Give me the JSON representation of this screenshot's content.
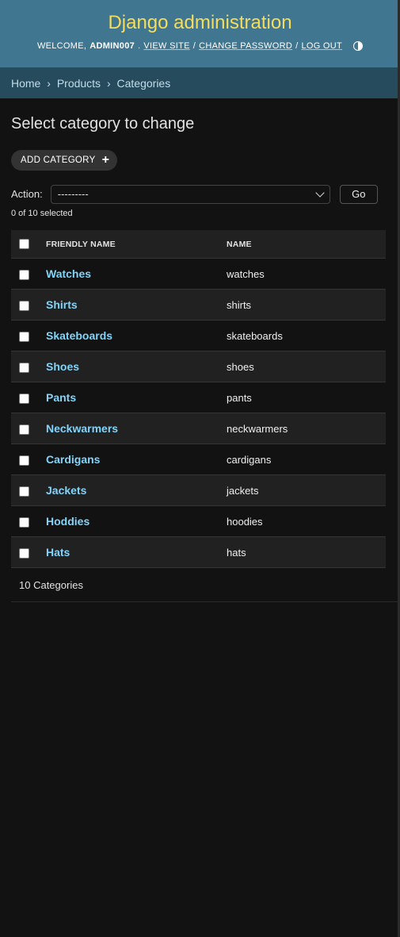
{
  "header": {
    "site_name": "Django administration",
    "welcome": "Welcome,",
    "username": "admin007",
    "view_site": "View site",
    "change_password": "Change password",
    "log_out": "Log out",
    "sep": "/"
  },
  "breadcrumbs": {
    "home": "Home",
    "app": "Products",
    "model": "Categories",
    "sep": "›"
  },
  "page": {
    "title": "Select category to change",
    "add_label": "Add category",
    "add_icon": "+"
  },
  "actions": {
    "label": "Action:",
    "selected_value": "---------",
    "go_label": "Go",
    "counter": "0 of 10 selected"
  },
  "table": {
    "columns": [
      "Friendly name",
      "Name"
    ],
    "rows": [
      {
        "friendly_name": "Watches",
        "name": "watches"
      },
      {
        "friendly_name": "Shirts",
        "name": "shirts"
      },
      {
        "friendly_name": "Skateboards",
        "name": "skateboards"
      },
      {
        "friendly_name": "Shoes",
        "name": "shoes"
      },
      {
        "friendly_name": "Pants",
        "name": "pants"
      },
      {
        "friendly_name": "Neckwarmers",
        "name": "neckwarmers"
      },
      {
        "friendly_name": "Cardigans",
        "name": "cardigans"
      },
      {
        "friendly_name": "Jackets",
        "name": "jackets"
      },
      {
        "friendly_name": "Hoddies",
        "name": "hoodies"
      },
      {
        "friendly_name": "Hats",
        "name": "hats"
      }
    ]
  },
  "paginator": "10 Categories",
  "colors": {
    "header_bg": "#417690",
    "site_name": "#f5dd5d",
    "breadcrumbs_bg": "#264b5d",
    "link": "#81d4fa",
    "body_bg": "#121212"
  }
}
